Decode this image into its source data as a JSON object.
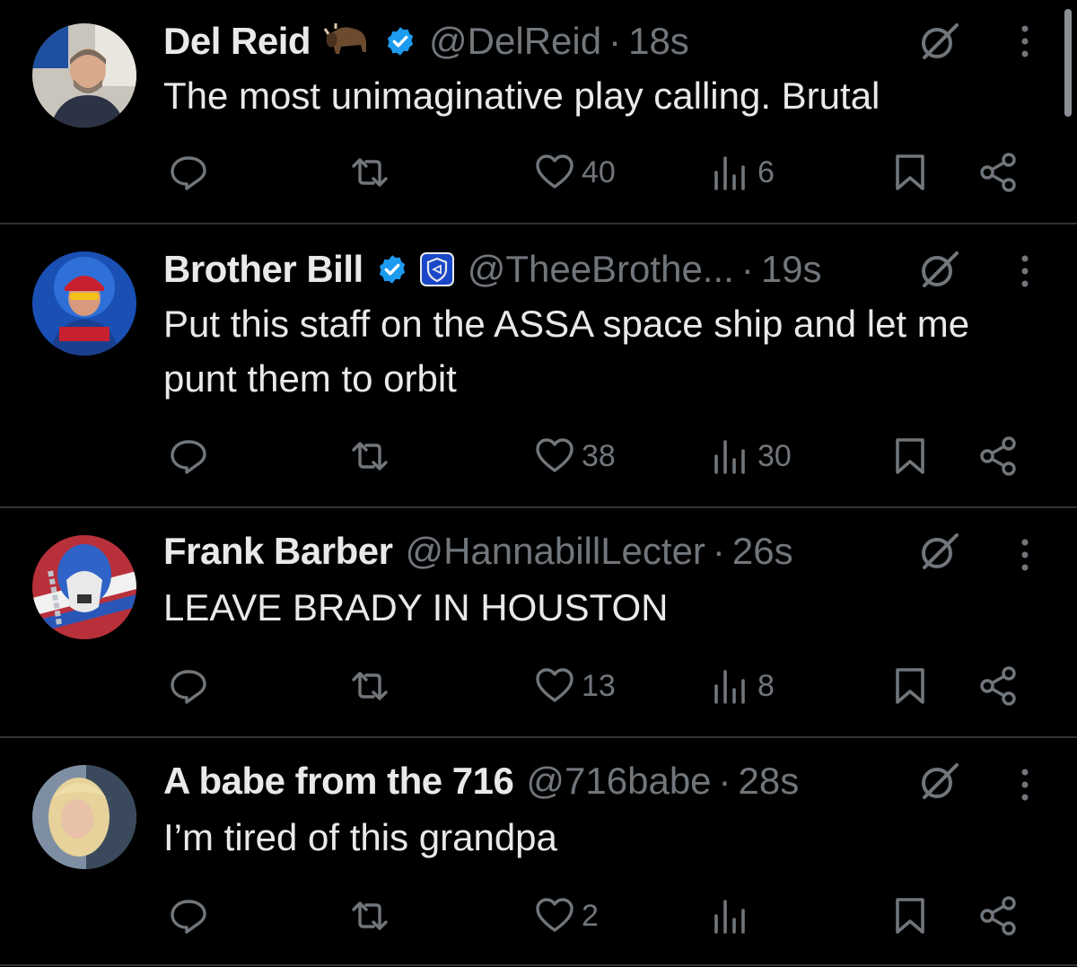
{
  "colors": {
    "background": "#000000",
    "text_primary": "#e7e9ea",
    "text_secondary": "#71767b",
    "divider": "#2f3336",
    "verified": "#1d9bf0"
  },
  "icons": {
    "reply": "reply-icon",
    "retweet": "retweet-icon",
    "like": "heart-icon",
    "views": "views-icon",
    "bookmark": "bookmark-icon",
    "share": "share-icon",
    "grok": "grok-icon",
    "more": "more-vertical-icon"
  },
  "tweets": [
    {
      "name": "Del Reid",
      "handle": "@DelReid",
      "separator": "·",
      "time": "18s",
      "text": "The most unimaginative play calling. Brutal",
      "likes": "40",
      "views": "6",
      "verified": true,
      "emoji": "bison-emoji"
    },
    {
      "name": "Brother Bill",
      "handle": "@TheeBrothe...",
      "separator": "·",
      "time": "19s",
      "text": "Put this staff on the ASSA space ship and let me punt them to orbit",
      "likes": "38",
      "views": "30",
      "verified": true,
      "affiliate_badge": "shield-badge-icon"
    },
    {
      "name": "Frank Barber",
      "handle": "@HannabillLecter",
      "separator": "·",
      "time": "26s",
      "text": "LEAVE BRADY IN HOUSTON",
      "likes": "13",
      "views": "8",
      "verified": false
    },
    {
      "name": "A babe from the 716",
      "handle": "@716babe",
      "separator": "·",
      "time": "28s",
      "text": "I’m tired of this grandpa",
      "likes": "2",
      "views": "",
      "verified": false
    }
  ]
}
